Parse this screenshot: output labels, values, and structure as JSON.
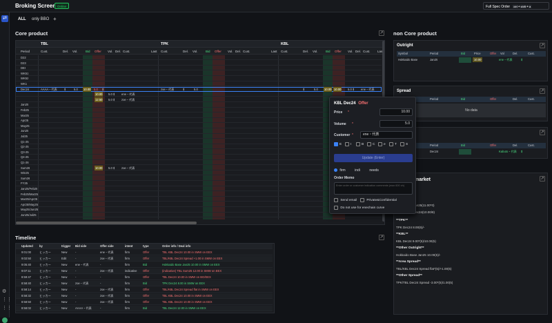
{
  "header": {
    "title": "Broking Screen",
    "status": "Online",
    "full_spec_label": "Full Spec Order",
    "shortcut": [
      "ctrl",
      "shift",
      "a"
    ]
  },
  "tabs": [
    "ALL",
    "only BBO",
    "+"
  ],
  "core": {
    "title": "Core product",
    "groups": [
      "TBL",
      "TPK",
      "KBL"
    ],
    "period_header": "Period",
    "col_headers": [
      "Cust.",
      "Del.",
      "Vol.",
      "Bid",
      "Offer",
      "Vol.",
      "Del.",
      "Cust.",
      "Last"
    ],
    "periods": [
      "D22",
      "D23",
      "DEI",
      "WK51",
      "WK52",
      "WK1",
      "Dec24",
      "",
      "",
      "Jan25",
      "Feb25",
      "Mar25",
      "Apr25",
      "May25",
      "Jun25",
      "Jul25",
      "Q1-25",
      "Q2-25",
      "Q3-25",
      "Q4-25",
      "Q1-26",
      "Sum26",
      "Win25",
      "Sum26",
      "FY25",
      "Jan25/Feb25",
      "Feb25/Mar25",
      "Mar25/Apr25",
      "Apr25/May25",
      "May25/Jun25",
      "Jun25/Jul25"
    ],
    "dec24_row": {
      "cust": "AAAA・代表",
      "del": "$",
      "vol": "5.0",
      "bid": "10.00",
      "offer": "5.0",
      "vol2": "$",
      "tpk_cust": "zoe・代表",
      "tpk_del": "$",
      "tpk_vol": "5.0",
      "kbl_del": "$",
      "kbl_vol": "5.0",
      "kbl_bid": "10.00",
      "kbl_offer": "10.00",
      "kbl_vol2": "5.0 $",
      "kbl_cust": "ene・代表"
    },
    "sub_row1": {
      "bid": "10.00",
      "vol": "5.0 $",
      "cust": "ene・代表"
    },
    "sub_row2": {
      "bid": "12.50",
      "vol": "5.0 $",
      "cust": "zoe・代表"
    },
    "sum26_row": {
      "bid": "10.00",
      "vol": "5.0 $",
      "cust": "zoe・代表"
    }
  },
  "noncore": {
    "title": "non Core product",
    "outright": {
      "title": "Outright",
      "headers": [
        "Symbol",
        "Period",
        "Bid",
        "Price",
        "Offer",
        "Vol",
        "Del.",
        "Cust."
      ],
      "row": {
        "symbol": "Hokkaido Base",
        "period": "Jan25",
        "price": "10.00",
        "cust": "ene・代表",
        "del": "$"
      }
    },
    "spread": {
      "title": "Spread",
      "headers": [
        "Period",
        "Bid",
        "Offer",
        "Del.",
        "Cust."
      ],
      "empty": "No data"
    },
    "third": {
      "headers": [
        "Period",
        "Bid",
        "Offer",
        "Del.",
        "Cust."
      ],
      "row": {
        "period": "Dec24",
        "cust": "Kabuto・代表",
        "del": "$"
      }
    },
    "market": {
      "title": "market",
      "lines": [
        "Jan25(11.00*0)",
        "Dec24(10.00/8)"
      ],
      "sections": [
        {
          "h": "**TPK**",
          "t": "TPK Dec24 8.00(5)/-"
        },
        {
          "h": "**KBL**",
          "t": "KBL Dec24 9.00*(5)/10.00(5)"
        },
        {
          "h": "**Other Outright**",
          "t": "Hokkaido Base Jan25 10.00(5)/-"
        },
        {
          "h": "**Area Spread**",
          "t": "TBL/KBL Dec24 Spread flat*(5)/+1.00(5)"
        },
        {
          "h": "**Other Spread**",
          "t": "TPK/TBL Dec24 Spread -3.00*(5)/1.00(5)"
        }
      ]
    }
  },
  "order_panel": {
    "title_symbol": "KBL Dec24",
    "title_side": "Offer",
    "price_label": "Price",
    "price_value": "10.00",
    "volume_label": "Volume",
    "volume_value": "5.0",
    "customer_label": "Customer",
    "customer_value": "ene・代表",
    "letters": [
      "E",
      "I",
      "B",
      "C",
      "e",
      "T",
      "S"
    ],
    "update_button": "Update (Enter)",
    "radios": [
      "firm",
      "indi",
      "needs"
    ],
    "memo_label": "Order Memo",
    "memo_placeholder": "Enter order or customer indication comments (max 600 ch)",
    "checks": [
      "Send email",
      "Private&Confidential",
      "Do not use for enechain curve"
    ]
  },
  "timeline": {
    "title": "Timeline",
    "headers": [
      "Updated",
      "by",
      "trigger",
      "Bid side",
      "Offer side",
      "intent",
      "type",
      "Order info / Deal info"
    ],
    "rows": [
      [
        "9:01:00",
        "ヒッカー",
        "New",
        "-",
        "ene・代表",
        "firm",
        "Offer",
        "TBL KBL Dec24 10.00 in SMW on EEX",
        "off"
      ],
      [
        "9:02:50",
        "ヒッカー",
        "Edit",
        "-",
        "zoe・代表",
        "firm",
        "Offer",
        "TBL/KBL Dec24 Spread +1.00 in SMW on EEX",
        "off"
      ],
      [
        "9:05:40",
        "ヒッカー",
        "New",
        "ene・代表",
        "-",
        "firm",
        "Bid",
        "Hokkaido Base Jan25 10.00 in SMW on EEX",
        "bid"
      ],
      [
        "9:07:11",
        "ヒッカー",
        "New",
        "-",
        "zoe・代表",
        "indicative",
        "Offer",
        "(indicative) TBL Sum25 12.00 in SMW on EEX",
        "off"
      ],
      [
        "8:59:47",
        "ヒッカー",
        "New",
        "-",
        "-",
        "firm",
        "Offer",
        "TBL Dec24 10.00 in SMW on BG/EEX",
        "off"
      ],
      [
        "8:58:40",
        "ヒッカー",
        "New",
        "zoe・代表",
        "-",
        "firm",
        "Bid",
        "TPK Dec24 8.00 in SMW on EEX",
        "bid"
      ],
      [
        "8:58:14",
        "ヒッカー",
        "New",
        "-",
        "zoe・代表",
        "firm",
        "Offer",
        "TBL/KBL Dec24 Spread flat in SMW on EEX",
        "off"
      ],
      [
        "8:58:32",
        "ヒッカー",
        "New",
        "-",
        "zoe・代表",
        "firm",
        "Offer",
        "TBL KBL Dec24 10.00 in SMW on EEX",
        "off"
      ],
      [
        "8:58:50",
        "ヒッカー",
        "New",
        "-",
        "zoe・代表",
        "firm",
        "Offer",
        "TBL KBL Dec24 10.00 in SMW on EEX",
        "off"
      ],
      [
        "8:58:02",
        "ヒッカー",
        "New",
        "AAAA・代表",
        "-",
        "firm",
        "Bid",
        "TBL Dec24 12.00 in SMW on EEX",
        "bid"
      ]
    ]
  },
  "colors": {
    "bid": "#1f4d3a",
    "offer": "#5a2a2a",
    "accent": "#3b82f6",
    "online": "#22c55e"
  }
}
